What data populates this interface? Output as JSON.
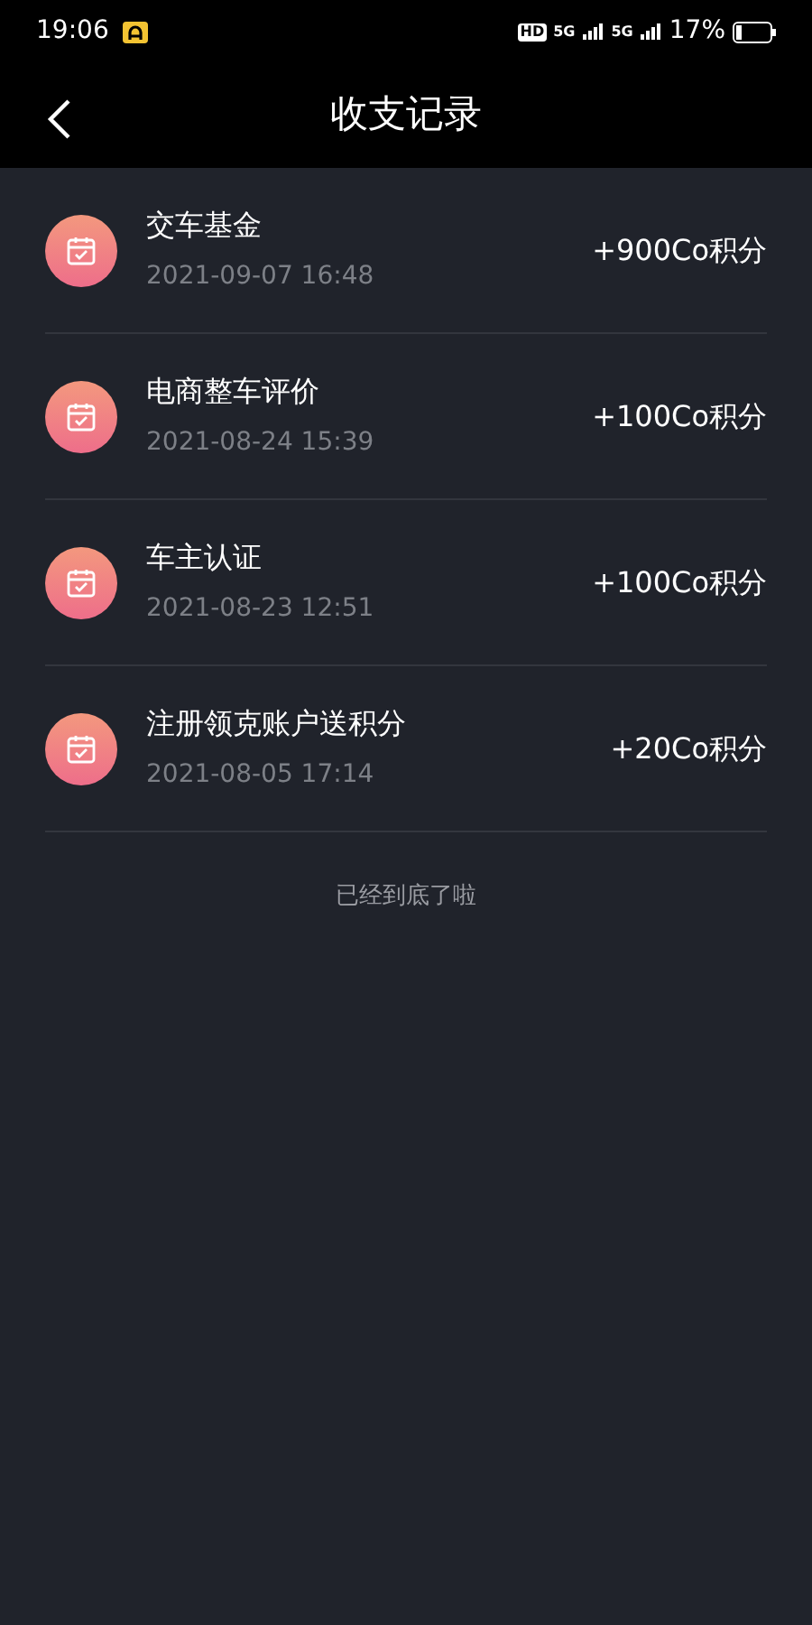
{
  "status_bar": {
    "time": "19:06",
    "hd": "HD",
    "networks": [
      "5G",
      "5G"
    ],
    "battery_text": "17%"
  },
  "header": {
    "title": "收支记录"
  },
  "records": [
    {
      "title": "交车基金",
      "time": "2021-09-07 16:48",
      "amount": "+900Co积分"
    },
    {
      "title": "电商整车评价",
      "time": "2021-08-24 15:39",
      "amount": "+100Co积分"
    },
    {
      "title": "车主认证",
      "time": "2021-08-23 12:51",
      "amount": "+100Co积分"
    },
    {
      "title": "注册领克账户送积分",
      "time": "2021-08-05 17:14",
      "amount": "+20Co积分"
    }
  ],
  "footer": "已经到底了啦"
}
